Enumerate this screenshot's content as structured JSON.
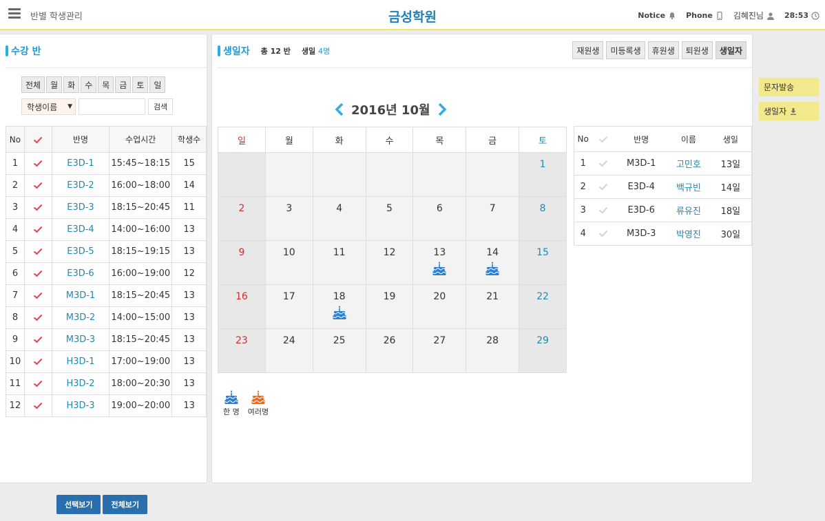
{
  "header": {
    "breadcrumb": "반별 학생관리",
    "brand": "금성학원",
    "notice_label": "Notice",
    "phone_label": "Phone",
    "user_label": "김혜진님",
    "timer": "28:53"
  },
  "left_panel": {
    "title": "수강 반",
    "day_buttons": [
      "전체",
      "월",
      "화",
      "수",
      "목",
      "금",
      "토",
      "일"
    ],
    "search_select": "학생이름",
    "search_value": "",
    "search_button": "검색",
    "columns": [
      "No",
      "✔",
      "반명",
      "수업시간",
      "학생수"
    ],
    "rows": [
      {
        "no": "1",
        "name": "E3D-1",
        "time": "15:45~18:15",
        "count": "15"
      },
      {
        "no": "2",
        "name": "E3D-2",
        "time": "16:00~18:00",
        "count": "14"
      },
      {
        "no": "3",
        "name": "E3D-3",
        "time": "18:15~20:45",
        "count": "11"
      },
      {
        "no": "4",
        "name": "E3D-4",
        "time": "14:00~16:00",
        "count": "13"
      },
      {
        "no": "5",
        "name": "E3D-5",
        "time": "18:15~19:15",
        "count": "13"
      },
      {
        "no": "6",
        "name": "E3D-6",
        "time": "16:00~19:00",
        "count": "12"
      },
      {
        "no": "7",
        "name": "M3D-1",
        "time": "18:15~20:45",
        "count": "13"
      },
      {
        "no": "8",
        "name": "M3D-2",
        "time": "14:00~15:00",
        "count": "13"
      },
      {
        "no": "9",
        "name": "M3D-3",
        "time": "18:15~20:45",
        "count": "13"
      },
      {
        "no": "10",
        "name": "H3D-1",
        "time": "17:00~19:00",
        "count": "13"
      },
      {
        "no": "11",
        "name": "H3D-2",
        "time": "18:00~20:30",
        "count": "13"
      },
      {
        "no": "12",
        "name": "H3D-3",
        "time": "19:00~20:00",
        "count": "13"
      }
    ]
  },
  "bottom_buttons": {
    "select_view": "선택보기",
    "all_view": "전체보기"
  },
  "mid_panel": {
    "title": "생일자",
    "total_label": "총 12 반",
    "birthday_label": "생일",
    "birthday_count": "4명",
    "status_buttons": [
      "재원생",
      "미등록생",
      "휴원생",
      "퇴원생",
      "생일자"
    ],
    "active_status": "생일자",
    "calendar": {
      "month_title": "2016년 10월",
      "weekdays": [
        "일",
        "월",
        "화",
        "수",
        "목",
        "금",
        "토"
      ],
      "weeks": [
        [
          "",
          "",
          "",
          "",
          "",
          "",
          "1"
        ],
        [
          "2",
          "3",
          "4",
          "5",
          "6",
          "7",
          "8"
        ],
        [
          "9",
          "10",
          "11",
          "12",
          "13",
          "14",
          "15"
        ],
        [
          "16",
          "17",
          "18",
          "19",
          "20",
          "21",
          "22"
        ],
        [
          "23",
          "24",
          "25",
          "26",
          "27",
          "28",
          "29"
        ]
      ],
      "birthday_days": [
        "13",
        "14",
        "18"
      ],
      "single_color": "#2c7fd1",
      "multi_color": "#ec6a1e"
    },
    "legend": {
      "single": "한 명",
      "multiple": "여러명"
    },
    "birthday_list": {
      "columns": [
        "No",
        "✔",
        "반명",
        "이름",
        "생일"
      ],
      "rows": [
        {
          "no": "1",
          "class": "M3D-1",
          "name": "고민호",
          "day": "13일"
        },
        {
          "no": "2",
          "class": "E3D-4",
          "name": "백규빈",
          "day": "14일"
        },
        {
          "no": "3",
          "class": "E3D-6",
          "name": "류유진",
          "day": "18일"
        },
        {
          "no": "4",
          "class": "M3D-3",
          "name": "박영진",
          "day": "30일"
        }
      ]
    }
  },
  "side_buttons": {
    "sms": "문자발송",
    "birthday_download": "생일자"
  },
  "colors": {
    "accent": "#1f9ad6",
    "brand": "#1f7fb6",
    "check": "#e84b5a",
    "side": "#f2e98c",
    "button_blue": "#2a6fad"
  }
}
